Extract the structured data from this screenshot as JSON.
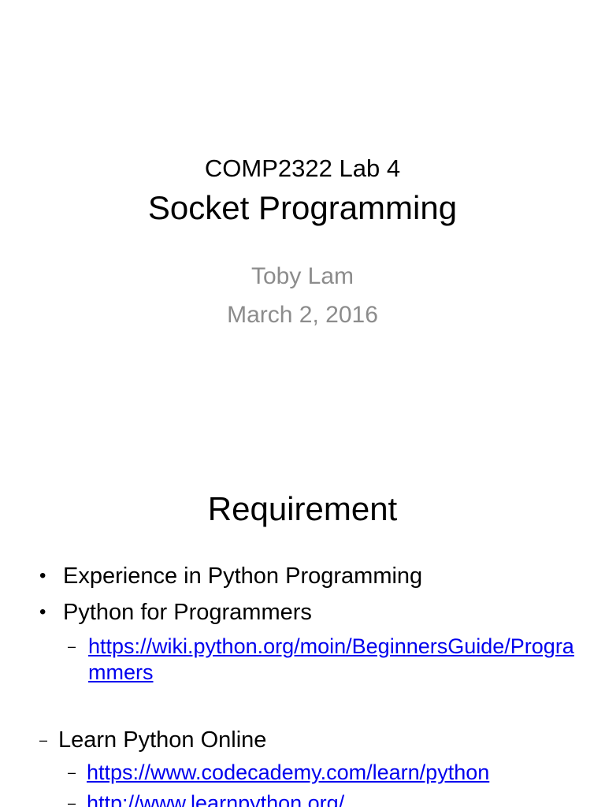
{
  "slide1": {
    "course": "COMP2322 Lab 4",
    "title": "Socket Programming",
    "author": "Toby Lam",
    "date": "March 2, 2016"
  },
  "slide2": {
    "title": "Requirement",
    "bullets": [
      "Experience in Python Programming",
      "Python for Programmers"
    ],
    "python_for_programmers_link": "https://wiki.python.org/moin/BeginnersGuide/Programmers",
    "learn_online_label": "Learn Python Online",
    "learn_online_links": [
      "https://www.codecademy.com/learn/python",
      "http://www.learnpython.org/"
    ],
    "bullet_glyph": "•",
    "dash_glyph": "–"
  },
  "colors": {
    "text": "#000000",
    "subtitle": "#8c8c8c",
    "link": "#0000ee"
  }
}
